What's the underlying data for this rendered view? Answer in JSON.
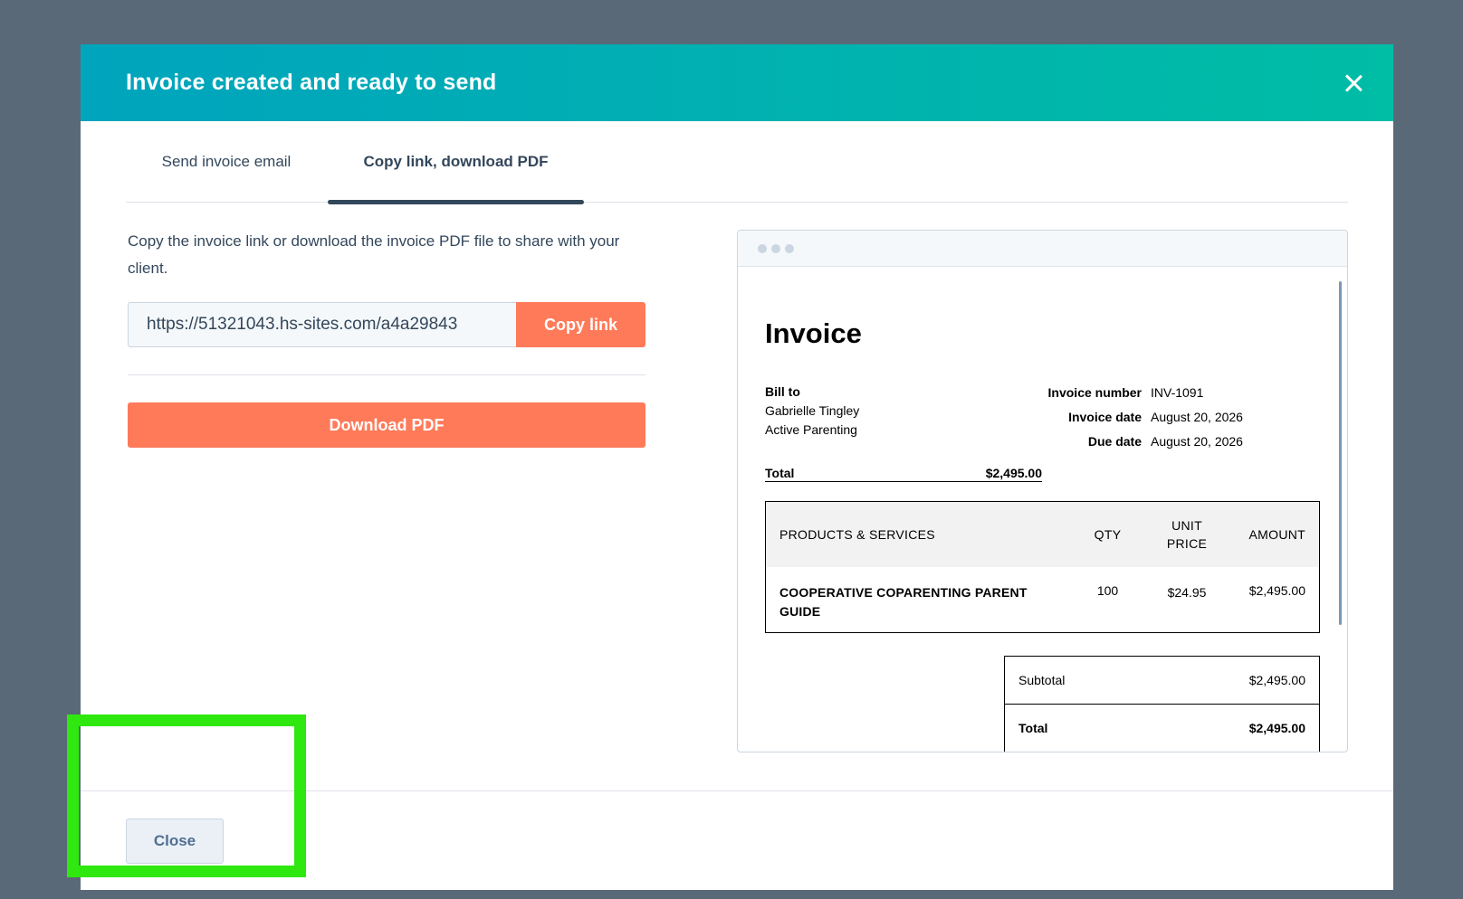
{
  "modal": {
    "title": "Invoice created and ready to send",
    "close_icon": "close-icon"
  },
  "tabs": [
    {
      "label": "Send invoice email",
      "active": false
    },
    {
      "label": "Copy link, download PDF",
      "active": true
    }
  ],
  "share": {
    "description": "Copy the invoice link or download the invoice PDF file to share with your client.",
    "link_value": "https://51321043.hs-sites.com/a4a29843",
    "copy_label": "Copy link",
    "download_label": "Download PDF"
  },
  "invoice": {
    "title": "Invoice",
    "bill_to_label": "Bill to",
    "bill_to_name": "Gabrielle Tingley",
    "bill_to_company": "Active Parenting",
    "meta": [
      {
        "label": "Invoice number",
        "value": "INV-1091"
      },
      {
        "label": "Invoice date",
        "value": "August 20, 2026"
      },
      {
        "label": "Due date",
        "value": "August 20, 2026"
      }
    ],
    "total_label": "Total",
    "total_value": "$2,495.00",
    "columns": {
      "name": "PRODUCTS & SERVICES",
      "qty": "QTY",
      "unit_line1": "UNIT",
      "unit_line2": "PRICE",
      "amount": "AMOUNT"
    },
    "items": [
      {
        "name": "COOPERATIVE COPARENTING PARENT GUIDE",
        "qty": "100",
        "unit_price": "$24.95",
        "amount": "$2,495.00"
      }
    ],
    "subtotal_label": "Subtotal",
    "subtotal_value": "$2,495.00",
    "grand_total_label": "Total",
    "grand_total_value": "$2,495.00"
  },
  "footer": {
    "close_label": "Close"
  },
  "colors": {
    "header_start": "#00a4bd",
    "header_end": "#00bda5",
    "primary_button": "#ff7a59",
    "highlight": "#2ee80f",
    "backdrop": "#5a6978"
  }
}
